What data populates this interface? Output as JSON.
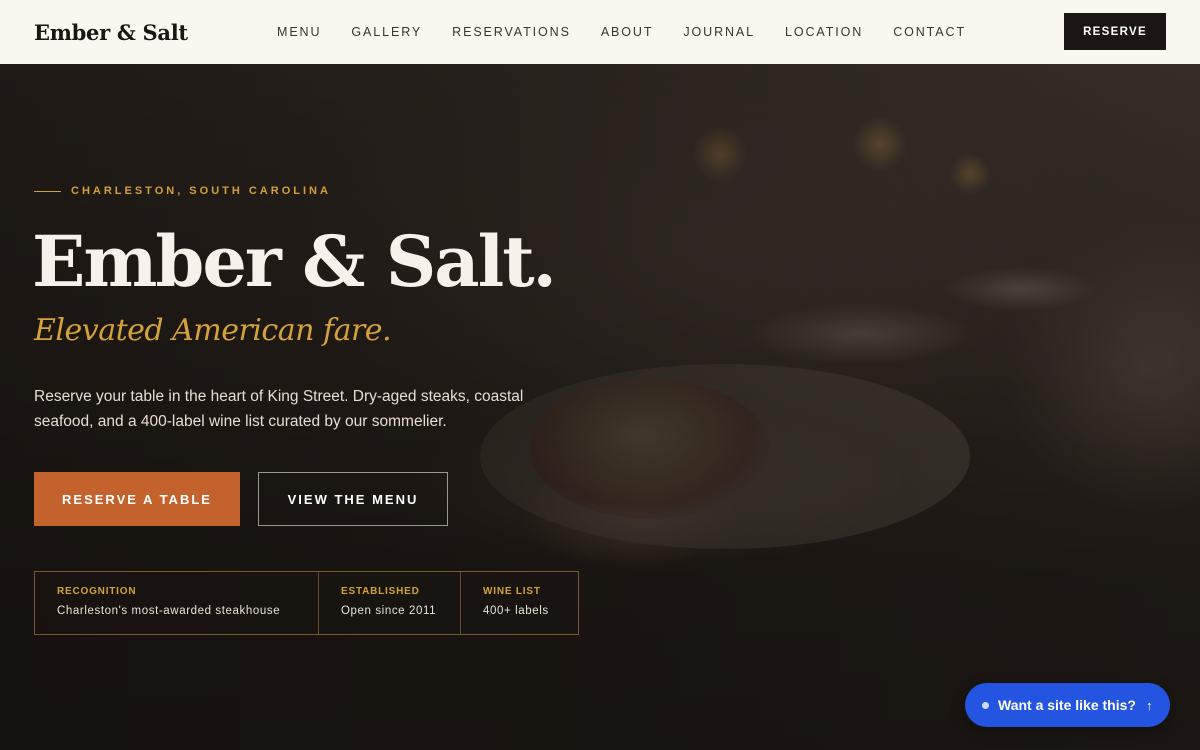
{
  "header": {
    "logo": "Ember & Salt",
    "nav": [
      "MENU",
      "GALLERY",
      "RESERVATIONS",
      "ABOUT",
      "JOURNAL",
      "LOCATION",
      "CONTACT"
    ],
    "reserve_label": "RESERVE"
  },
  "hero": {
    "eyebrow": "CHARLESTON, SOUTH CAROLINA",
    "title": "Ember & Salt.",
    "subtitle": "Elevated American fare.",
    "description": "Reserve your table in the heart of King Street. Dry-aged steaks, coastal seafood, and a 400-label wine list curated by our sommelier.",
    "primary_cta": "RESERVE A TABLE",
    "secondary_cta": "VIEW THE MENU"
  },
  "stats": [
    {
      "label": "RECOGNITION",
      "value": "Charleston's most-awarded steakhouse"
    },
    {
      "label": "ESTABLISHED",
      "value": "Open since 2011"
    },
    {
      "label": "WINE LIST",
      "value": "400+ labels"
    }
  ],
  "promo": {
    "label": "Want a site like this?",
    "arrow_icon": "arrow-up-icon"
  },
  "colors": {
    "accent_gold": "#d4a23a",
    "accent_orange": "#c4622d",
    "promo_blue": "#2455e0"
  }
}
